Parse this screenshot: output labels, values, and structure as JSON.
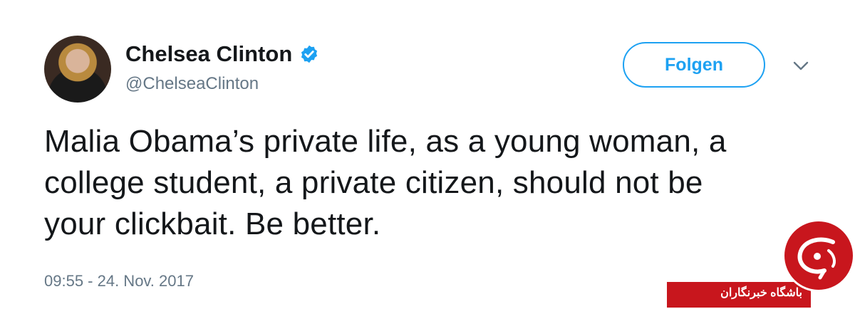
{
  "tweet": {
    "author_name": "Chelsea Clinton",
    "handle": "@ChelseaClinton",
    "follow_label": "Folgen",
    "text": "Malia Obama’s private life, as a young woman, a college student, a private citizen, should not be your clickbait. Be better.",
    "timestamp": "09:55 - 24. Nov. 2017"
  },
  "icons": {
    "verified": "verified-badge-icon",
    "menu": "chevron-down-icon"
  },
  "watermark": {
    "text": "باشگاه خبرنگاران"
  },
  "colors": {
    "accent": "#1da1f2",
    "text": "#14171a",
    "secondary": "#657786",
    "watermark_red": "#c8161d"
  }
}
